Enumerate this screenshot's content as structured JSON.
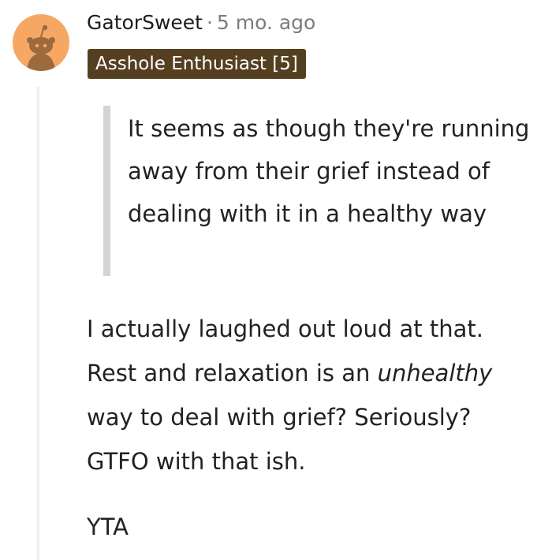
{
  "comment": {
    "username": "GatorSweet",
    "separator": "·",
    "timestamp": "5 mo. ago",
    "flair": "Asshole Enthusiast [5]",
    "quote": "It seems as though they're running away from their grief instead of dealing with it in a healthy way",
    "body": {
      "line1": "I actually laughed out loud at that.",
      "line2_start": "Rest and relaxation is an ",
      "line2_emphasis": "unhealthy",
      "line3": "way to deal with grief? Seriously?",
      "line4": "GTFO with that ish."
    },
    "verdict": "YTA"
  },
  "avatar": {
    "icon": "snoo-avatar-icon",
    "background_color": "#f7a764"
  },
  "colors": {
    "flair_background": "#544020",
    "quote_bar": "#d4d4d4",
    "thread_line": "#ededed"
  }
}
